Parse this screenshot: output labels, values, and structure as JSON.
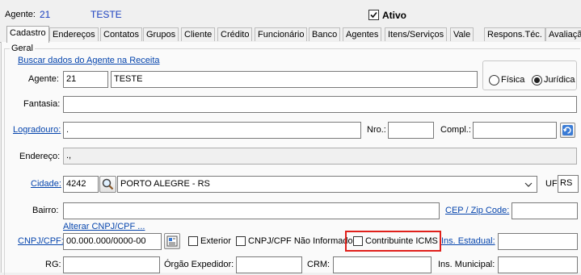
{
  "header": {
    "agente_label": "Agente:",
    "agente_code": "21",
    "agente_name": "TESTE",
    "ativo_label": "Ativo",
    "ativo_checked": true
  },
  "tabs": [
    "Cadastro",
    "Endereços",
    "Contatos",
    "Grupos",
    "Cliente",
    "Crédito",
    "Funcionário",
    "Banco",
    "Agentes",
    "Itens/Serviços",
    "Vale",
    "Respons.Téc.",
    "Avaliaçã"
  ],
  "active_tab": "Cadastro",
  "form": {
    "group_label": "Geral",
    "buscar_link": "Buscar dados do Agente na Receita",
    "agente_label": "Agente:",
    "agente_code": "21",
    "agente_name": "TESTE",
    "tipo": {
      "fisica_label": "Física",
      "juridica_label": "Jurídica",
      "selected": "Jurídica"
    },
    "fantasia_label": "Fantasia:",
    "fantasia_value": "",
    "logradouro_label": "Logradouro:",
    "logradouro_value": ".",
    "nro_label": "Nro.:",
    "nro_value": "",
    "compl_label": "Compl.:",
    "compl_value": "",
    "endereco_label": "Endereço:",
    "endereco_value": ".,",
    "cidade_label": "Cidade:",
    "cidade_code": "4242",
    "cidade_name": "PORTO ALEGRE - RS",
    "uf_label": "UF:",
    "uf_value": "RS",
    "bairro_label": "Bairro:",
    "bairro_value": "",
    "cep_label": "CEP / Zip Code:",
    "cep_value": "",
    "alterar_link": "Alterar CNPJ/CPF ...",
    "cnpj_label": "CNPJ/CPF:",
    "cnpj_value": "00.000.000/0000-00",
    "exterior_label": "Exterior",
    "nao_informado_label": "CNPJ/CPF Não Informado",
    "contribuinte_label": "Contribuinte ICMS",
    "ins_estadual_label": "Ins. Estadual:",
    "ins_estadual_value": "",
    "rg_label": "RG:",
    "orgao_label": "Órgão Expedidor:",
    "crm_label": "CRM:",
    "ins_municipal_label": "Ins. Municipal:"
  },
  "colors": {
    "highlight": "#e0201b",
    "link": "#0645ad",
    "header_value": "#1a3fbf"
  },
  "icons": [
    "search-icon",
    "search-icon",
    "refresh-icon",
    "card-icon",
    "dropdown-chevron-icon",
    "checkmark-icon"
  ]
}
